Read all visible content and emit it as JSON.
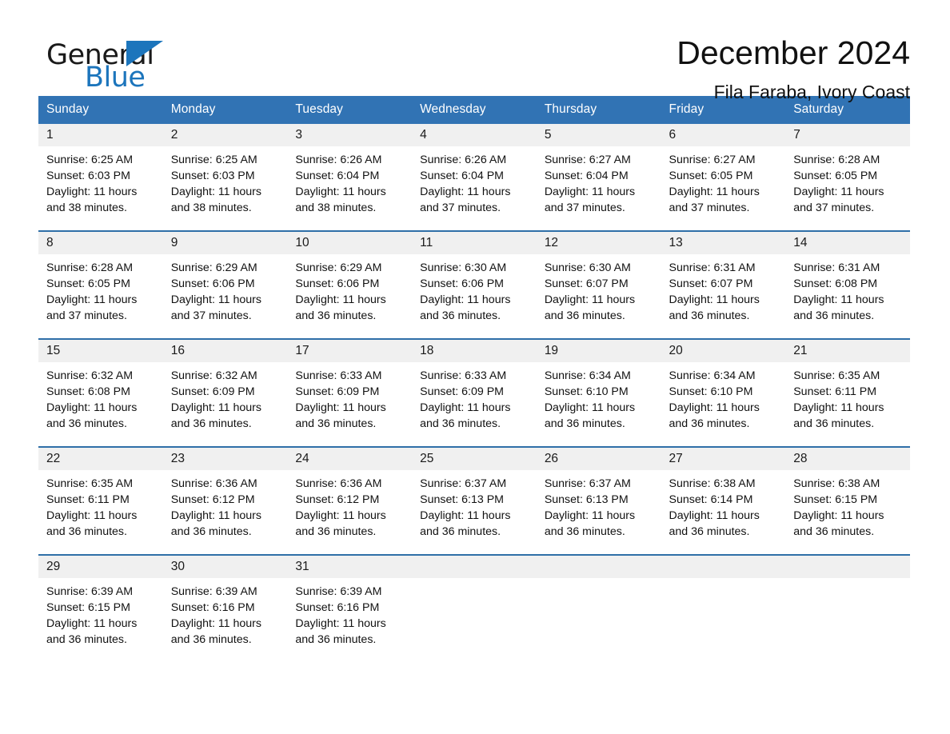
{
  "brand": {
    "name_part1": "General",
    "name_part2": "Blue",
    "flag_icon": "triangle-flag-icon",
    "accent_color": "#1c75bc"
  },
  "header": {
    "title": "December 2024",
    "subtitle": "Fila Faraba, Ivory Coast"
  },
  "calendar": {
    "header_bg": "#3173b4",
    "row_divider_color": "#2f6fa8",
    "daynum_band_bg": "#f0f0f0",
    "weekday_headers": [
      "Sunday",
      "Monday",
      "Tuesday",
      "Wednesday",
      "Thursday",
      "Friday",
      "Saturday"
    ],
    "weeks": [
      [
        {
          "day": "1",
          "sunrise": "Sunrise: 6:25 AM",
          "sunset": "Sunset: 6:03 PM",
          "daylight_line1": "Daylight: 11 hours",
          "daylight_line2": "and 38 minutes."
        },
        {
          "day": "2",
          "sunrise": "Sunrise: 6:25 AM",
          "sunset": "Sunset: 6:03 PM",
          "daylight_line1": "Daylight: 11 hours",
          "daylight_line2": "and 38 minutes."
        },
        {
          "day": "3",
          "sunrise": "Sunrise: 6:26 AM",
          "sunset": "Sunset: 6:04 PM",
          "daylight_line1": "Daylight: 11 hours",
          "daylight_line2": "and 38 minutes."
        },
        {
          "day": "4",
          "sunrise": "Sunrise: 6:26 AM",
          "sunset": "Sunset: 6:04 PM",
          "daylight_line1": "Daylight: 11 hours",
          "daylight_line2": "and 37 minutes."
        },
        {
          "day": "5",
          "sunrise": "Sunrise: 6:27 AM",
          "sunset": "Sunset: 6:04 PM",
          "daylight_line1": "Daylight: 11 hours",
          "daylight_line2": "and 37 minutes."
        },
        {
          "day": "6",
          "sunrise": "Sunrise: 6:27 AM",
          "sunset": "Sunset: 6:05 PM",
          "daylight_line1": "Daylight: 11 hours",
          "daylight_line2": "and 37 minutes."
        },
        {
          "day": "7",
          "sunrise": "Sunrise: 6:28 AM",
          "sunset": "Sunset: 6:05 PM",
          "daylight_line1": "Daylight: 11 hours",
          "daylight_line2": "and 37 minutes."
        }
      ],
      [
        {
          "day": "8",
          "sunrise": "Sunrise: 6:28 AM",
          "sunset": "Sunset: 6:05 PM",
          "daylight_line1": "Daylight: 11 hours",
          "daylight_line2": "and 37 minutes."
        },
        {
          "day": "9",
          "sunrise": "Sunrise: 6:29 AM",
          "sunset": "Sunset: 6:06 PM",
          "daylight_line1": "Daylight: 11 hours",
          "daylight_line2": "and 37 minutes."
        },
        {
          "day": "10",
          "sunrise": "Sunrise: 6:29 AM",
          "sunset": "Sunset: 6:06 PM",
          "daylight_line1": "Daylight: 11 hours",
          "daylight_line2": "and 36 minutes."
        },
        {
          "day": "11",
          "sunrise": "Sunrise: 6:30 AM",
          "sunset": "Sunset: 6:06 PM",
          "daylight_line1": "Daylight: 11 hours",
          "daylight_line2": "and 36 minutes."
        },
        {
          "day": "12",
          "sunrise": "Sunrise: 6:30 AM",
          "sunset": "Sunset: 6:07 PM",
          "daylight_line1": "Daylight: 11 hours",
          "daylight_line2": "and 36 minutes."
        },
        {
          "day": "13",
          "sunrise": "Sunrise: 6:31 AM",
          "sunset": "Sunset: 6:07 PM",
          "daylight_line1": "Daylight: 11 hours",
          "daylight_line2": "and 36 minutes."
        },
        {
          "day": "14",
          "sunrise": "Sunrise: 6:31 AM",
          "sunset": "Sunset: 6:08 PM",
          "daylight_line1": "Daylight: 11 hours",
          "daylight_line2": "and 36 minutes."
        }
      ],
      [
        {
          "day": "15",
          "sunrise": "Sunrise: 6:32 AM",
          "sunset": "Sunset: 6:08 PM",
          "daylight_line1": "Daylight: 11 hours",
          "daylight_line2": "and 36 minutes."
        },
        {
          "day": "16",
          "sunrise": "Sunrise: 6:32 AM",
          "sunset": "Sunset: 6:09 PM",
          "daylight_line1": "Daylight: 11 hours",
          "daylight_line2": "and 36 minutes."
        },
        {
          "day": "17",
          "sunrise": "Sunrise: 6:33 AM",
          "sunset": "Sunset: 6:09 PM",
          "daylight_line1": "Daylight: 11 hours",
          "daylight_line2": "and 36 minutes."
        },
        {
          "day": "18",
          "sunrise": "Sunrise: 6:33 AM",
          "sunset": "Sunset: 6:09 PM",
          "daylight_line1": "Daylight: 11 hours",
          "daylight_line2": "and 36 minutes."
        },
        {
          "day": "19",
          "sunrise": "Sunrise: 6:34 AM",
          "sunset": "Sunset: 6:10 PM",
          "daylight_line1": "Daylight: 11 hours",
          "daylight_line2": "and 36 minutes."
        },
        {
          "day": "20",
          "sunrise": "Sunrise: 6:34 AM",
          "sunset": "Sunset: 6:10 PM",
          "daylight_line1": "Daylight: 11 hours",
          "daylight_line2": "and 36 minutes."
        },
        {
          "day": "21",
          "sunrise": "Sunrise: 6:35 AM",
          "sunset": "Sunset: 6:11 PM",
          "daylight_line1": "Daylight: 11 hours",
          "daylight_line2": "and 36 minutes."
        }
      ],
      [
        {
          "day": "22",
          "sunrise": "Sunrise: 6:35 AM",
          "sunset": "Sunset: 6:11 PM",
          "daylight_line1": "Daylight: 11 hours",
          "daylight_line2": "and 36 minutes."
        },
        {
          "day": "23",
          "sunrise": "Sunrise: 6:36 AM",
          "sunset": "Sunset: 6:12 PM",
          "daylight_line1": "Daylight: 11 hours",
          "daylight_line2": "and 36 minutes."
        },
        {
          "day": "24",
          "sunrise": "Sunrise: 6:36 AM",
          "sunset": "Sunset: 6:12 PM",
          "daylight_line1": "Daylight: 11 hours",
          "daylight_line2": "and 36 minutes."
        },
        {
          "day": "25",
          "sunrise": "Sunrise: 6:37 AM",
          "sunset": "Sunset: 6:13 PM",
          "daylight_line1": "Daylight: 11 hours",
          "daylight_line2": "and 36 minutes."
        },
        {
          "day": "26",
          "sunrise": "Sunrise: 6:37 AM",
          "sunset": "Sunset: 6:13 PM",
          "daylight_line1": "Daylight: 11 hours",
          "daylight_line2": "and 36 minutes."
        },
        {
          "day": "27",
          "sunrise": "Sunrise: 6:38 AM",
          "sunset": "Sunset: 6:14 PM",
          "daylight_line1": "Daylight: 11 hours",
          "daylight_line2": "and 36 minutes."
        },
        {
          "day": "28",
          "sunrise": "Sunrise: 6:38 AM",
          "sunset": "Sunset: 6:15 PM",
          "daylight_line1": "Daylight: 11 hours",
          "daylight_line2": "and 36 minutes."
        }
      ],
      [
        {
          "day": "29",
          "sunrise": "Sunrise: 6:39 AM",
          "sunset": "Sunset: 6:15 PM",
          "daylight_line1": "Daylight: 11 hours",
          "daylight_line2": "and 36 minutes."
        },
        {
          "day": "30",
          "sunrise": "Sunrise: 6:39 AM",
          "sunset": "Sunset: 6:16 PM",
          "daylight_line1": "Daylight: 11 hours",
          "daylight_line2": "and 36 minutes."
        },
        {
          "day": "31",
          "sunrise": "Sunrise: 6:39 AM",
          "sunset": "Sunset: 6:16 PM",
          "daylight_line1": "Daylight: 11 hours",
          "daylight_line2": "and 36 minutes."
        },
        {
          "day": "",
          "sunrise": "",
          "sunset": "",
          "daylight_line1": "",
          "daylight_line2": ""
        },
        {
          "day": "",
          "sunrise": "",
          "sunset": "",
          "daylight_line1": "",
          "daylight_line2": ""
        },
        {
          "day": "",
          "sunrise": "",
          "sunset": "",
          "daylight_line1": "",
          "daylight_line2": ""
        },
        {
          "day": "",
          "sunrise": "",
          "sunset": "",
          "daylight_line1": "",
          "daylight_line2": ""
        }
      ]
    ]
  }
}
